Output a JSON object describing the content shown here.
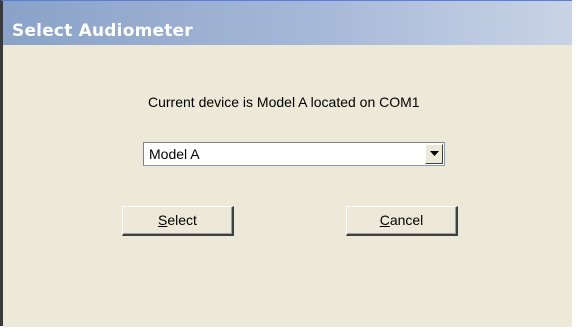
{
  "window": {
    "title": "Select Audiometer"
  },
  "dialog": {
    "info_text": "Current device is Model A located on COM1",
    "device_select": {
      "selected": "Model A"
    },
    "buttons": {
      "select": {
        "mnemonic": "S",
        "rest": "elect"
      },
      "cancel": {
        "mnemonic": "C",
        "rest": "ancel"
      }
    }
  },
  "icons": {
    "dropdown": "chevron-down-icon"
  },
  "colors": {
    "dialog_background": "#ece9d8",
    "title_gradient_start": "#8aa2c8",
    "title_gradient_end": "#c9d3e5",
    "title_text": "#ffffff"
  }
}
